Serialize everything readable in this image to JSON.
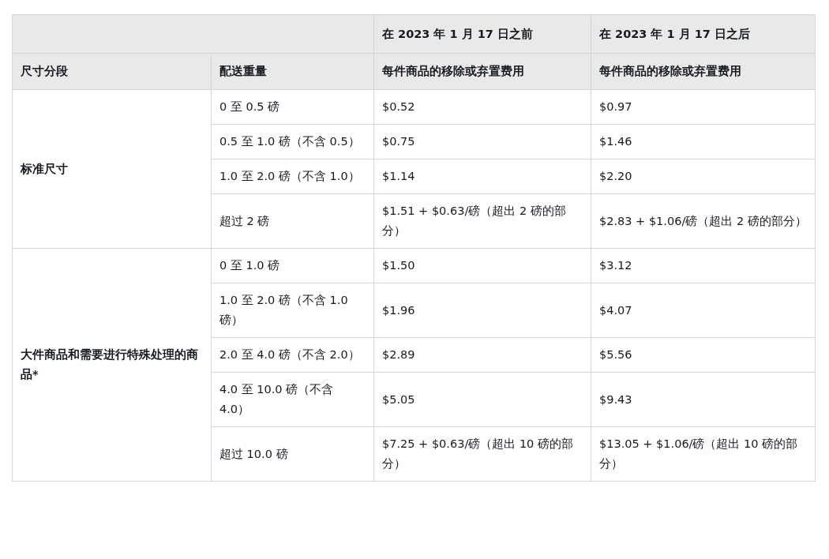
{
  "table": {
    "header_top": [
      "在 2023 年 1 月 17 日之前",
      "在 2023 年 1 月 17 日之后"
    ],
    "columns": [
      "尺寸分段",
      "配送重量",
      "每件商品的移除或弃置费用",
      "每件商品的移除或弃置费用"
    ],
    "groups": [
      {
        "size_tier": "标准尺寸",
        "rows": [
          {
            "weight": "0 至 0.5 磅",
            "before": "$0.52",
            "after": "$0.97"
          },
          {
            "weight": "0.5 至 1.0 磅（不含 0.5）",
            "before": "$0.75",
            "after": "$1.46"
          },
          {
            "weight": "1.0 至 2.0 磅（不含 1.0）",
            "before": "$1.14",
            "after": "$2.20"
          },
          {
            "weight": "超过 2 磅",
            "before": "$1.51 + $0.63/磅（超出 2 磅的部分）",
            "after": "$2.83 + $1.06/磅（超出 2 磅的部分）"
          }
        ]
      },
      {
        "size_tier": "大件商品和需要进行特殊处理的商品*",
        "rows": [
          {
            "weight": "0 至 1.0 磅",
            "before": "$1.50",
            "after": "$3.12"
          },
          {
            "weight": "1.0 至 2.0 磅（不含 1.0 磅）",
            "before": "$1.96",
            "after": "$4.07"
          },
          {
            "weight": "2.0 至 4.0 磅（不含 2.0）",
            "before": "$2.89",
            "after": "$5.56"
          },
          {
            "weight": "4.0 至 10.0 磅（不含 4.0）",
            "before": "$5.05",
            "after": "$9.43"
          },
          {
            "weight": "超过 10.0 磅",
            "before": "$7.25 + $0.63/磅（超出 10 磅的部分）",
            "after": "$13.05 + $1.06/磅（超出 10 磅的部分）"
          }
        ]
      }
    ]
  }
}
